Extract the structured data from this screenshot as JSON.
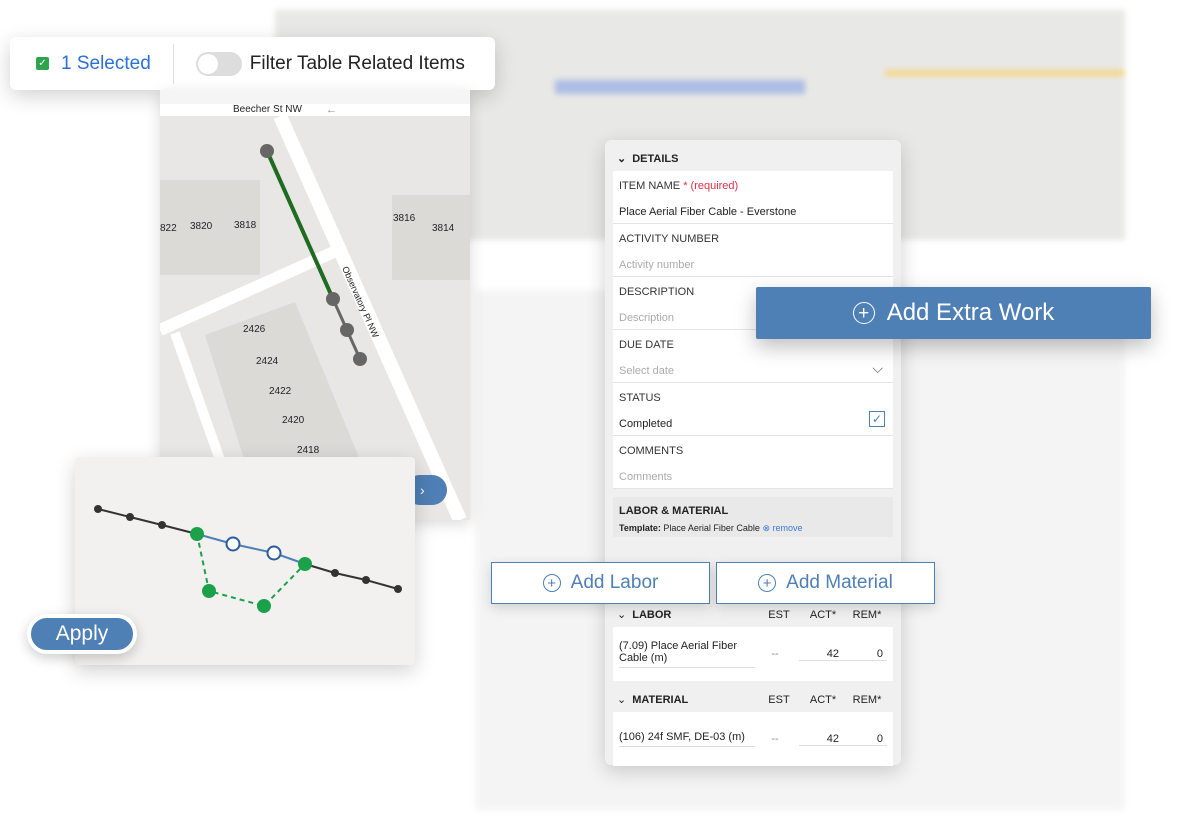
{
  "topbar": {
    "selected_label": "1 Selected",
    "filter_label": "Filter Table Related Items",
    "filter_on": false
  },
  "map": {
    "street_top": "Beecher St NW",
    "street_diag": "Observatory Pl NW",
    "labels": [
      "822",
      "3820",
      "3818",
      "3816",
      "3814",
      "2426",
      "2424",
      "2422",
      "2420",
      "2418"
    ]
  },
  "apply_label": "Apply",
  "form": {
    "details_title": "DETAILS",
    "fields": [
      {
        "label": "ITEM NAME",
        "required": "* (required)",
        "value": "Place Aerial Fiber Cable - Everstone",
        "placeholder": ""
      },
      {
        "label": "ACTIVITY NUMBER",
        "value": "",
        "placeholder": "Activity number"
      },
      {
        "label": "DESCRIPTION",
        "value": "",
        "placeholder": "Description"
      },
      {
        "label": "DUE DATE",
        "value": "",
        "placeholder": "Select date"
      },
      {
        "label": "STATUS",
        "value": "Completed",
        "checked": true
      },
      {
        "label": "COMMENTS",
        "value": "",
        "placeholder": "Comments"
      }
    ],
    "lm_title": "LABOR & MATERIAL",
    "template_label": "Template:",
    "template_value": "Place Aerial Fiber Cable",
    "remove_label": "remove",
    "labor": {
      "title": "LABOR",
      "cols": [
        "EST",
        "ACT*",
        "REM*"
      ],
      "row": {
        "name": "(7.09) Place Aerial Fiber Cable (m)",
        "est": "--",
        "act": "42",
        "rem": "0"
      }
    },
    "material": {
      "title": "MATERIAL",
      "cols": [
        "EST",
        "ACT*",
        "REM*"
      ],
      "row": {
        "name": "(106) 24f SMF, DE-03 (m)",
        "est": "--",
        "act": "42",
        "rem": "0"
      }
    }
  },
  "buttons": {
    "add_extra_work": "Add Extra Work",
    "add_labor": "Add Labor",
    "add_material": "Add Material"
  },
  "colors": {
    "accent": "#4e7fb5",
    "green": "#2da44e",
    "route": "#1f6b1f"
  }
}
